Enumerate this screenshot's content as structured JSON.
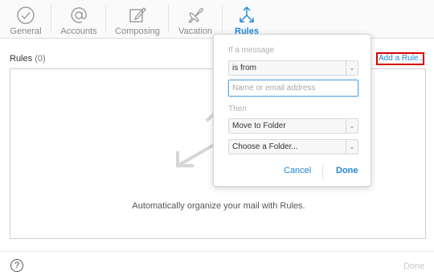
{
  "tabs": [
    {
      "label": "General",
      "icon": "check-circle-icon"
    },
    {
      "label": "Accounts",
      "icon": "at-sign-icon"
    },
    {
      "label": "Composing",
      "icon": "compose-icon"
    },
    {
      "label": "Vacation",
      "icon": "airplane-icon"
    },
    {
      "label": "Rules",
      "icon": "rules-arrows-icon",
      "active": true
    }
  ],
  "rules": {
    "title": "Rules",
    "count": "(0)",
    "add_label": "Add a Rule..."
  },
  "panel": {
    "empty_message": "Automatically organize your mail with Rules."
  },
  "popover": {
    "if_label": "If a message",
    "condition_value": "is from",
    "address_placeholder": "Name or email address",
    "then_label": "Then",
    "action_value": "Move to Folder",
    "folder_value": "Choose a Folder...",
    "cancel_label": "Cancel",
    "done_label": "Done"
  },
  "footer": {
    "help_label": "?",
    "done_label": "Done"
  },
  "colors": {
    "accent": "#1e88d8",
    "highlight_border": "#d80000",
    "inactive_text": "#888888"
  }
}
